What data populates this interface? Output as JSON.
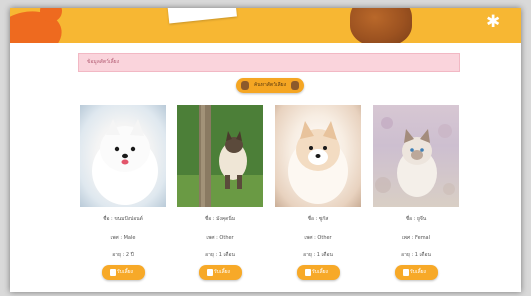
{
  "info_bar": {
    "text": "ข้อมูลสัตว์เลี้ยง"
  },
  "filter_button": {
    "label": "ค้นหาสัตว์เลี้ยง"
  },
  "pets": [
    {
      "name": "ชื่อ : ขนมปังปอนด์",
      "type": "เพศ : Male",
      "age": "อายุ : 2 ปี",
      "button": "รับเลี้ยง"
    },
    {
      "name": "ชื่อ : มังคุดนิ่ม",
      "type": "เพศ : Other",
      "age": "อายุ : 1 เดือน",
      "button": "รับเลี้ยง"
    },
    {
      "name": "ชื่อ : ซูกัส",
      "type": "เพศ : Other",
      "age": "อายุ : 1 เดือน",
      "button": "รับเลี้ยง"
    },
    {
      "name": "ชื่อ : ยูจีน",
      "type": "เพศ : Femal",
      "age": "อายุ : 1 เดือน",
      "button": "รับเลี้ยง"
    }
  ]
}
